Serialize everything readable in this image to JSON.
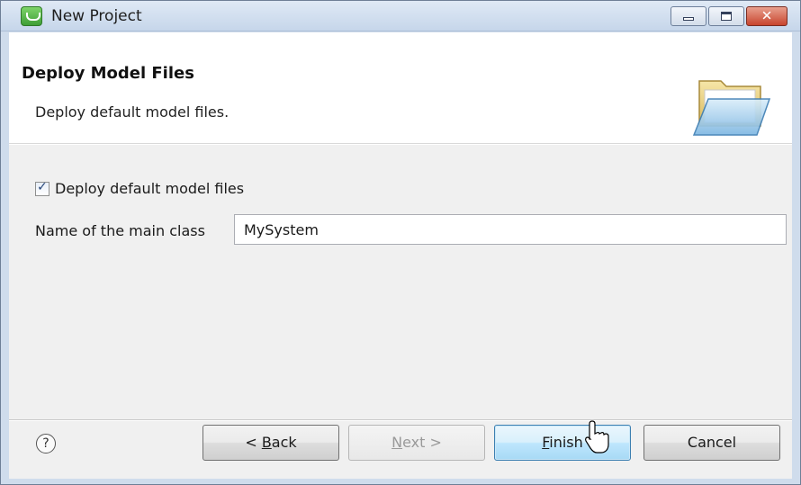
{
  "window": {
    "title": "New Project",
    "controls": {
      "minimize_icon": "minimize-icon",
      "maximize_icon": "maximize-icon",
      "close_icon": "close-icon",
      "close_glyph": "✕"
    }
  },
  "header": {
    "title": "Deploy Model Files",
    "description": "Deploy default model files.",
    "icon": "open-folder-icon"
  },
  "form": {
    "deploy_checkbox": {
      "label": "Deploy default model files",
      "checked": true,
      "tick": "✓"
    },
    "main_class": {
      "label": "Name of the main class",
      "value": "MySystem"
    }
  },
  "footer": {
    "help_icon": "?",
    "back": {
      "prefix": "< ",
      "mnemonic": "B",
      "rest": "ack"
    },
    "next": {
      "mnemonic": "N",
      "rest": "ext >",
      "enabled": false
    },
    "finish": {
      "mnemonic": "F",
      "rest": "inish"
    },
    "cancel": {
      "label": "Cancel"
    }
  },
  "colors": {
    "title_bar": "#c6d6ea",
    "close_button": "#c8452e",
    "finish_button": "#bee6fd",
    "panel": "#f0f0f0"
  }
}
